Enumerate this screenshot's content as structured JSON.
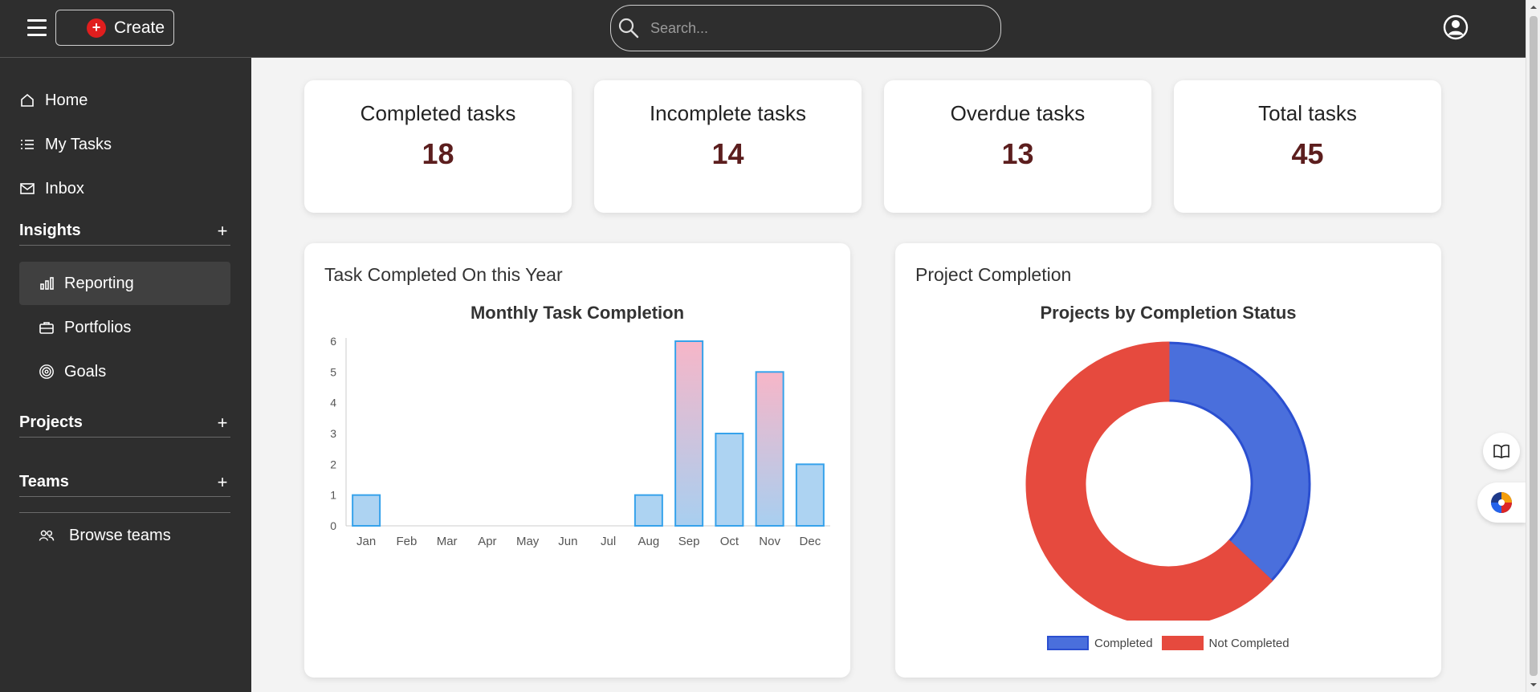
{
  "header": {
    "create_label": "Create",
    "search_placeholder": "Search..."
  },
  "sidebar": {
    "items": [
      {
        "label": "Home",
        "icon": "home-icon"
      },
      {
        "label": "My Tasks",
        "icon": "list-icon"
      },
      {
        "label": "Inbox",
        "icon": "mail-icon"
      }
    ],
    "insights": {
      "title": "Insights",
      "items": [
        {
          "label": "Reporting",
          "icon": "chart-icon",
          "active": true
        },
        {
          "label": "Portfolios",
          "icon": "briefcase-icon"
        },
        {
          "label": "Goals",
          "icon": "target-icon"
        }
      ]
    },
    "projects": {
      "title": "Projects"
    },
    "teams": {
      "title": "Teams",
      "items": [
        {
          "label": "Browse teams",
          "icon": "users-icon"
        }
      ]
    }
  },
  "stats": [
    {
      "label": "Completed tasks",
      "value": "18"
    },
    {
      "label": "Incomplete tasks",
      "value": "14"
    },
    {
      "label": "Overdue tasks",
      "value": "13"
    },
    {
      "label": "Total tasks",
      "value": "45"
    }
  ],
  "panels": {
    "bar_panel_title": "Task Completed On this Year",
    "pie_panel_title": "Project Completion"
  },
  "colors": {
    "accent_dark": "#2e2e2e",
    "stat_value": "#5c1e1e",
    "bar_border": "#36a2eb",
    "pie_completed": "#4a6fdc",
    "pie_not_completed": "#e64a3e"
  },
  "chart_data": [
    {
      "type": "bar",
      "title": "Monthly Task Completion",
      "categories": [
        "Jan",
        "Feb",
        "Mar",
        "Apr",
        "May",
        "Jun",
        "Jul",
        "Aug",
        "Sep",
        "Oct",
        "Nov",
        "Dec"
      ],
      "values": [
        1,
        0,
        0,
        0,
        0,
        0,
        0,
        1,
        6,
        3,
        5,
        2
      ],
      "ylim": [
        0,
        6
      ],
      "yticks": [
        0,
        1,
        2,
        3,
        4,
        5,
        6
      ],
      "xlabel": "",
      "ylabel": "",
      "grid": false,
      "legend": "none"
    },
    {
      "type": "pie",
      "title": "Projects by Completion Status",
      "labels": [
        "Completed",
        "Not Completed"
      ],
      "values": [
        37,
        63
      ],
      "donut": true,
      "legend": "bottom"
    }
  ]
}
